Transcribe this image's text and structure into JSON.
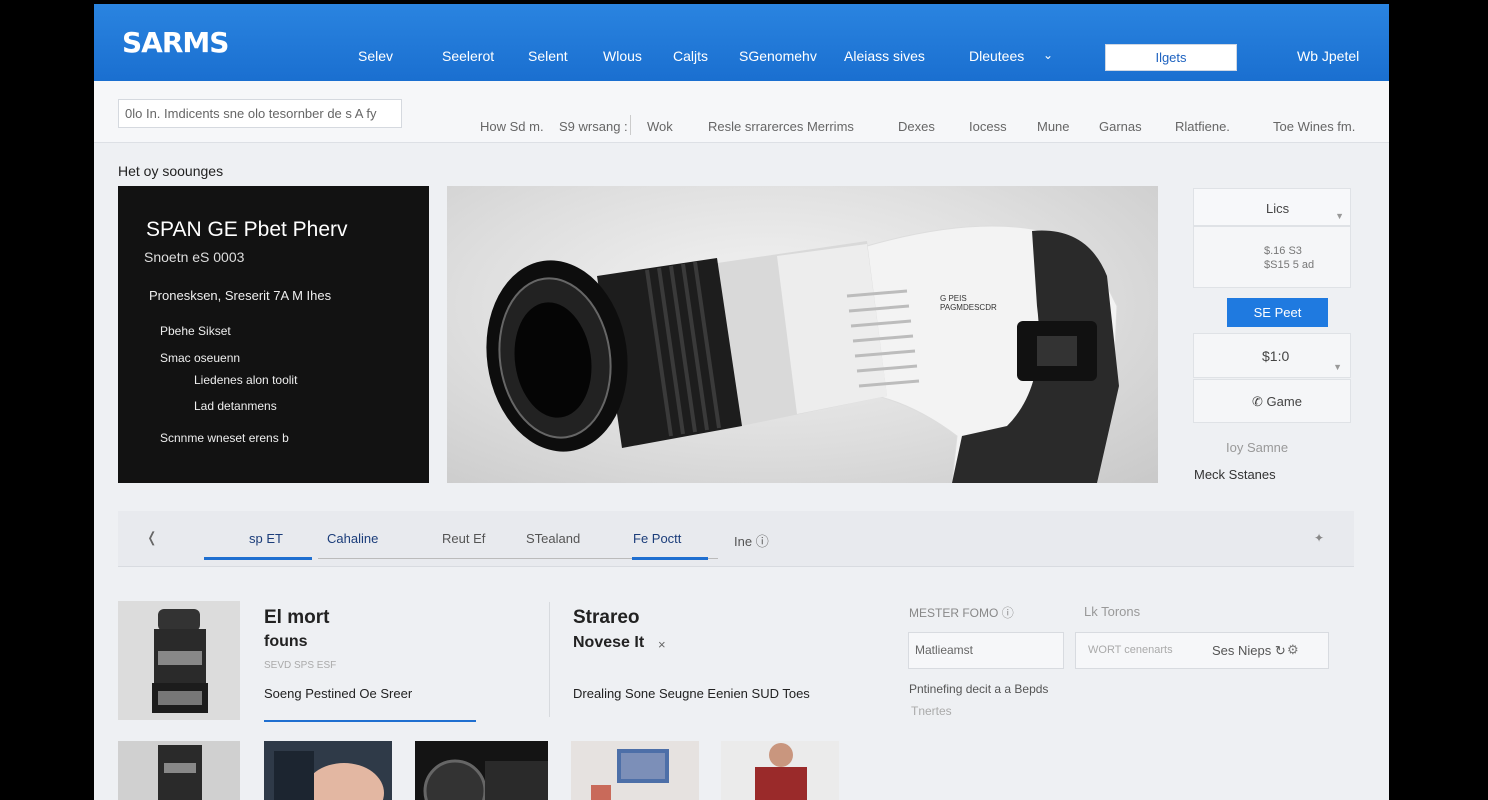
{
  "brand": {
    "logo": "SARMS"
  },
  "topnav": {
    "links": [
      "Selev",
      "Seelerot",
      "Selent",
      "Wlous",
      "Caljts",
      "SGenomehv",
      "Aleiass sives",
      "Dleutees"
    ],
    "search_label": "Ilgets",
    "right_label": "Wb Jpetel"
  },
  "subbar": {
    "search_value": "0lo In.   Imdicents sne olo tesornber de   s     A  fy",
    "links": [
      "How Sd m.",
      "S9 wrsang  :",
      "Wok",
      "Resle srrarerces Merrims",
      "Dexes",
      "Iocess",
      "Mune",
      "Garnas",
      "Rlatfiene.",
      "Toe Wines fm."
    ]
  },
  "section_title": "Het oy soounges",
  "hero": {
    "title": "SPAN GE Pbet Pherv",
    "subtitle": "Snoetn eS 0003",
    "lines": [
      "Pronesksen, Sreserit 7A M Ihes",
      "Pbehe Sikset",
      "Smac oseuenn",
      "Liedenes alon toolit",
      "Lad detanmens",
      "Scnnme wneset erens b"
    ],
    "image_label_1": "G PEIS",
    "image_label_2": "PAGMDESCDR"
  },
  "side": {
    "dropdown_label": "Lics",
    "price_1": "$.16 S3",
    "price_2": "$S15 5 ad",
    "buy_label": "SE Peet",
    "price_3": "$1:0",
    "game_label": "Game",
    "link_1": "Ioy Samne",
    "link_2": "Meck Sstanes"
  },
  "tabs": {
    "items": [
      "sp ET",
      "Cahaline",
      "Reut Ef",
      "STealand",
      "Fe Poctt",
      "Ine"
    ]
  },
  "card1": {
    "title": "El mort",
    "title2": "founs",
    "meta": "SEVD   SPS  ESF",
    "desc": "Soeng Pestined Oe Sreer"
  },
  "card2": {
    "title": "Strareo",
    "title2": "Novese It",
    "close": "×",
    "desc": "Drealing Sone Seugne Eenien SUD Toes"
  },
  "filters": {
    "label_1": "MESTER FOMO",
    "label_2": "Lk Torons",
    "input_1_value": "Matlieamst",
    "input_2_placeholder": "WORT cenenarts",
    "button_label": "Ses Nieps",
    "text_1": "Pntinefing decit a a Bepds",
    "text_2": "Tnertes"
  },
  "colors": {
    "accent": "#1f7ae0",
    "nav": "#1a6fd0",
    "hero_dark": "#121212"
  },
  "icons": [
    "chevron-down-icon",
    "phone-icon",
    "back-arrow-icon",
    "info-icon",
    "close-icon",
    "settings-icon"
  ]
}
